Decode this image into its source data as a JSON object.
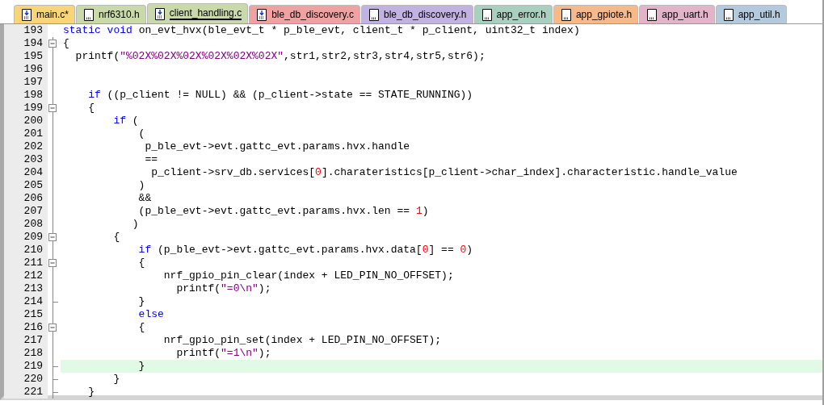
{
  "tabs": [
    {
      "label": "main.c*",
      "kind": "source",
      "color": "#f8d678",
      "selected": false
    },
    {
      "label": "nrf6310.h",
      "kind": "header",
      "color": "#c9d9a9",
      "selected": false
    },
    {
      "label": "client_handling.c",
      "kind": "source",
      "color": "#c9d9a9",
      "selected": true
    },
    {
      "label": "ble_db_discovery.c",
      "kind": "source",
      "color": "#f0a2a2",
      "selected": false
    },
    {
      "label": "ble_db_discovery.h",
      "kind": "header",
      "color": "#c2b2e2",
      "selected": false
    },
    {
      "label": "app_error.h",
      "kind": "header",
      "color": "#a9cfc0",
      "selected": false
    },
    {
      "label": "app_gpiote.h",
      "kind": "header",
      "color": "#f8b98a",
      "selected": false
    },
    {
      "label": "app_uart.h",
      "kind": "header",
      "color": "#e2b3c9",
      "selected": false
    },
    {
      "label": "app_util.h",
      "kind": "header",
      "color": "#b3c9de",
      "selected": false
    }
  ],
  "editor": {
    "lines": [
      {
        "number": "193",
        "current": false,
        "collapsible": false,
        "block_end": false,
        "tokens": [
          {
            "kind": "keyword",
            "text": "static void"
          },
          {
            "kind": "plain",
            "text": " on_evt_hvx(ble_evt_t * p_ble_evt, client_t * p_client, uint32_t index)"
          }
        ]
      },
      {
        "number": "194",
        "current": false,
        "collapsible": true,
        "block_end": false,
        "tokens": [
          {
            "kind": "plain",
            "text": "{"
          }
        ]
      },
      {
        "number": "195",
        "current": false,
        "collapsible": false,
        "block_end": false,
        "tokens": [
          {
            "kind": "plain",
            "text": "  printf("
          },
          {
            "kind": "string",
            "text": "\"%02X%02X%02X%02X%02X%02X\""
          },
          {
            "kind": "plain",
            "text": ",str1,str2,str3,str4,str5,str6);"
          }
        ]
      },
      {
        "number": "196",
        "current": false,
        "collapsible": false,
        "block_end": false
      },
      {
        "number": "197",
        "current": false,
        "collapsible": false,
        "block_end": false
      },
      {
        "number": "198",
        "current": false,
        "collapsible": false,
        "block_end": false,
        "tokens": [
          {
            "kind": "keyword",
            "text": "    if"
          },
          {
            "kind": "plain",
            "text": " ((p_client != NULL) && (p_client->state == STATE_RUNNING))"
          }
        ]
      },
      {
        "number": "199",
        "current": false,
        "collapsible": true,
        "block_end": false,
        "tokens": [
          {
            "kind": "plain",
            "text": "    {"
          }
        ]
      },
      {
        "number": "200",
        "current": false,
        "collapsible": false,
        "block_end": false,
        "tokens": [
          {
            "kind": "keyword",
            "text": "        if"
          },
          {
            "kind": "plain",
            "text": " ("
          }
        ]
      },
      {
        "number": "201",
        "current": false,
        "collapsible": false,
        "block_end": false,
        "tokens": [
          {
            "kind": "plain",
            "text": "            ("
          }
        ]
      },
      {
        "number": "202",
        "current": false,
        "collapsible": false,
        "block_end": false,
        "tokens": [
          {
            "kind": "plain",
            "text": "             p_ble_evt->evt.gattc_evt.params.hvx.handle"
          }
        ]
      },
      {
        "number": "203",
        "current": false,
        "collapsible": false,
        "block_end": false,
        "tokens": [
          {
            "kind": "plain",
            "text": "             =="
          }
        ]
      },
      {
        "number": "204",
        "current": false,
        "collapsible": false,
        "block_end": false,
        "tokens": [
          {
            "kind": "plain",
            "text": "              p_client->srv_db.services["
          },
          {
            "kind": "number",
            "text": "0"
          },
          {
            "kind": "plain",
            "text": "].charateristics[p_client->char_index].characteristic.handle_value"
          }
        ]
      },
      {
        "number": "205",
        "current": false,
        "collapsible": false,
        "block_end": false,
        "tokens": [
          {
            "kind": "plain",
            "text": "            )"
          }
        ]
      },
      {
        "number": "206",
        "current": false,
        "collapsible": false,
        "block_end": false,
        "tokens": [
          {
            "kind": "plain",
            "text": "            &&"
          }
        ]
      },
      {
        "number": "207",
        "current": false,
        "collapsible": false,
        "block_end": false,
        "tokens": [
          {
            "kind": "plain",
            "text": "            (p_ble_evt->evt.gattc_evt.params.hvx.len == "
          },
          {
            "kind": "number",
            "text": "1"
          },
          {
            "kind": "plain",
            "text": ")"
          }
        ]
      },
      {
        "number": "208",
        "current": false,
        "collapsible": false,
        "block_end": false,
        "tokens": [
          {
            "kind": "plain",
            "text": "           )"
          }
        ]
      },
      {
        "number": "209",
        "current": false,
        "collapsible": true,
        "block_end": false,
        "tokens": [
          {
            "kind": "plain",
            "text": "        {"
          }
        ]
      },
      {
        "number": "210",
        "current": false,
        "collapsible": false,
        "block_end": false,
        "tokens": [
          {
            "kind": "keyword",
            "text": "            if"
          },
          {
            "kind": "plain",
            "text": " (p_ble_evt->evt.gattc_evt.params.hvx.data["
          },
          {
            "kind": "number",
            "text": "0"
          },
          {
            "kind": "plain",
            "text": "] == "
          },
          {
            "kind": "number",
            "text": "0"
          },
          {
            "kind": "plain",
            "text": ")"
          }
        ]
      },
      {
        "number": "211",
        "current": false,
        "collapsible": true,
        "block_end": false,
        "tokens": [
          {
            "kind": "plain",
            "text": "            {"
          }
        ]
      },
      {
        "number": "212",
        "current": false,
        "collapsible": false,
        "block_end": false,
        "tokens": [
          {
            "kind": "plain",
            "text": "                nrf_gpio_pin_clear(index + LED_PIN_NO_OFFSET);"
          }
        ]
      },
      {
        "number": "213",
        "current": false,
        "collapsible": false,
        "block_end": false,
        "tokens": [
          {
            "kind": "plain",
            "text": "                  printf("
          },
          {
            "kind": "string",
            "text": "\"=0\\n\""
          },
          {
            "kind": "plain",
            "text": ");"
          }
        ]
      },
      {
        "number": "214",
        "current": false,
        "collapsible": false,
        "block_end": true,
        "tokens": [
          {
            "kind": "plain",
            "text": "            }"
          }
        ]
      },
      {
        "number": "215",
        "current": false,
        "collapsible": false,
        "block_end": false,
        "tokens": [
          {
            "kind": "keyword",
            "text": "            else"
          }
        ]
      },
      {
        "number": "216",
        "current": false,
        "collapsible": true,
        "block_end": false,
        "tokens": [
          {
            "kind": "plain",
            "text": "            {"
          }
        ]
      },
      {
        "number": "217",
        "current": false,
        "collapsible": false,
        "block_end": false,
        "tokens": [
          {
            "kind": "plain",
            "text": "                nrf_gpio_pin_set(index + LED_PIN_NO_OFFSET);"
          }
        ]
      },
      {
        "number": "218",
        "current": false,
        "collapsible": false,
        "block_end": false,
        "tokens": [
          {
            "kind": "plain",
            "text": "                  printf("
          },
          {
            "kind": "string",
            "text": "\"=1\\n\""
          },
          {
            "kind": "plain",
            "text": ");"
          }
        ]
      },
      {
        "number": "219",
        "current": true,
        "collapsible": false,
        "block_end": true,
        "tokens": [
          {
            "kind": "plain",
            "text": "            }"
          }
        ]
      },
      {
        "number": "220",
        "current": false,
        "collapsible": false,
        "block_end": true,
        "tokens": [
          {
            "kind": "plain",
            "text": "        }"
          }
        ]
      },
      {
        "number": "221",
        "current": false,
        "collapsible": false,
        "block_end": true,
        "tokens": [
          {
            "kind": "plain",
            "text": "    }"
          }
        ]
      }
    ]
  }
}
